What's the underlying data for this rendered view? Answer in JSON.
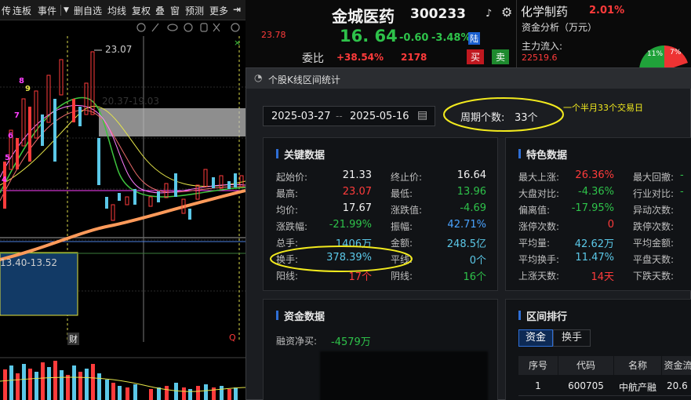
{
  "toolbar": {
    "items": [
      "传",
      "连板",
      "事件",
      "▼",
      "删自选",
      "均线",
      "复权",
      "叠",
      "窗",
      "预测",
      "更多"
    ]
  },
  "chart": {
    "high_label": "23.07",
    "range_label": "20.37-19.03",
    "box_label": "13.40-13.52",
    "side_price": "23.78",
    "wave_marks": [
      "8",
      "9",
      "7",
      "6",
      "5",
      "4"
    ],
    "footer_left": "财",
    "footer_right": "Q"
  },
  "stock": {
    "name": "金城医药",
    "code": "300233",
    "price": "16. 64",
    "change": "-0.60",
    "change_pct": "-3.48%",
    "badge": "陆",
    "weibi_label": "委比",
    "weibi_value": "+38.54%",
    "weibi_num": "2178",
    "sell": "买",
    "buy": "卖",
    "sector": "化学制药",
    "sector_pct": "2.01%",
    "capital_title": "资金分析（万元）",
    "mainflow_label": "主力流入:",
    "mainflow_value": "22519.6",
    "pie_a": "11%",
    "pie_b": "7%"
  },
  "dialog": {
    "title": "个股K线区间统计",
    "date_from": "2025-03-27",
    "date_sep": "--",
    "date_to": "2025-05-16",
    "period_label": "周期个数:",
    "period_value": "33个",
    "annotation": "一个半月33个交易日"
  },
  "key_data": {
    "title": "关键数据",
    "rows": [
      {
        "l1": "起始价:",
        "v1": "21.33",
        "c1": "white",
        "l2": "终止价:",
        "v2": "16.64",
        "c2": "white"
      },
      {
        "l1": "最高:",
        "v1": "23.07",
        "c1": "red",
        "l2": "最低:",
        "v2": "13.96",
        "c2": "green"
      },
      {
        "l1": "均价:",
        "v1": "17.67",
        "c1": "white",
        "l2": "涨跌值:",
        "v2": "-4.69",
        "c2": "green"
      },
      {
        "l1": "涨跌幅:",
        "v1": "-21.99%",
        "c1": "green",
        "l2": "振幅:",
        "v2": "42.71%",
        "c2": "blue"
      },
      {
        "l1": "总手:",
        "v1": "1406万",
        "c1": "cyan",
        "l2": "金额:",
        "v2": "248.5亿",
        "c2": "cyan"
      },
      {
        "l1": "换手:",
        "v1": "378.39%",
        "c1": "cyan",
        "l2": "平线:",
        "v2": "0个",
        "c2": "cyan"
      },
      {
        "l1": "阳线:",
        "v1": "17个",
        "c1": "red",
        "l2": "阴线:",
        "v2": "16个",
        "c2": "green"
      }
    ]
  },
  "features": {
    "title": "特色数据",
    "rows": [
      {
        "l1": "最大上涨:",
        "v1": "26.36%",
        "c1": "red",
        "l2": "最大回撤:",
        "v2": "-"
      },
      {
        "l1": "大盘对比:",
        "v1": "-4.36%",
        "c1": "green",
        "l2": "行业对比:",
        "v2": "-"
      },
      {
        "l1": "偏离值:",
        "v1": "-17.95%",
        "c1": "green",
        "l2": "异动次数:",
        "v2": ""
      },
      {
        "l1": "涨停次数:",
        "v1": "0",
        "c1": "red",
        "l2": "跌停次数:",
        "v2": ""
      },
      {
        "l1": "平均量:",
        "v1": "42.62万",
        "c1": "cyan",
        "l2": "平均金额:",
        "v2": ""
      },
      {
        "l1": "平均换手:",
        "v1": "11.47%",
        "c1": "cyan",
        "l2": "平盘天数:",
        "v2": ""
      },
      {
        "l1": "上涨天数:",
        "v1": "14天",
        "c1": "red",
        "l2": "下跌天数:",
        "v2": ""
      }
    ]
  },
  "funds": {
    "title": "资金数据",
    "net_label": "融资净买:",
    "net_value": "-4579万"
  },
  "ranking": {
    "title": "区间排行",
    "tabs": [
      "资金",
      "换手"
    ],
    "headers": [
      "序号",
      "代码",
      "名称",
      "资金流"
    ],
    "rows": [
      {
        "no": "1",
        "code": "600705",
        "name": "中航产融",
        "flow": "20.6"
      }
    ]
  },
  "colors": {
    "accent_blue": "#2f6fd6",
    "up_red": "#ff3b3b",
    "down_green": "#2ec24a",
    "highlight_yellow": "#f2ea1e"
  }
}
